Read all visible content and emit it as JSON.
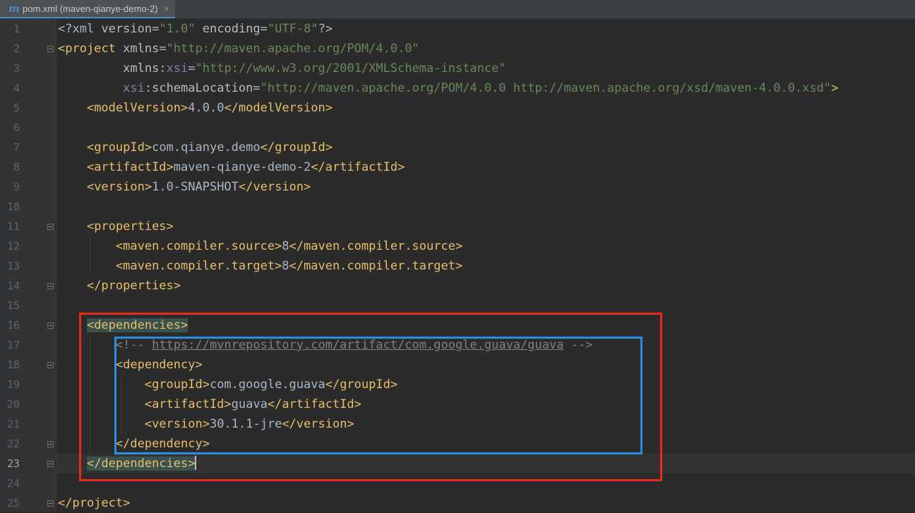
{
  "tab": {
    "icon": "maven-m-icon",
    "icon_glyph": "m",
    "title": "pom.xml (maven-qianye-demo-2)",
    "close_glyph": "×"
  },
  "current_line": 23,
  "lines": [
    {
      "n": "1",
      "tokens": [
        [
          "p",
          "<?xml "
        ],
        [
          "a",
          "version"
        ],
        [
          "p",
          "="
        ],
        [
          "v",
          "\"1.0\""
        ],
        [
          "p",
          " "
        ],
        [
          "a",
          "encoding"
        ],
        [
          "p",
          "="
        ],
        [
          "v",
          "\"UTF-8\""
        ],
        [
          "p",
          "?>"
        ]
      ]
    },
    {
      "n": "2",
      "tokens": [
        [
          "t",
          "<project "
        ],
        [
          "a",
          "xmlns"
        ],
        [
          "p",
          "="
        ],
        [
          "v",
          "\"http://maven.apache.org/POM/4.0.0\""
        ]
      ]
    },
    {
      "n": "3",
      "tokens": [
        [
          "p",
          "         "
        ],
        [
          "a",
          "xmlns"
        ],
        [
          "p",
          ":"
        ],
        [
          "n",
          "xsi"
        ],
        [
          "p",
          "="
        ],
        [
          "v",
          "\"http://www.w3.org/2001/XMLSchema-instance\""
        ]
      ]
    },
    {
      "n": "4",
      "tokens": [
        [
          "p",
          "         "
        ],
        [
          "n",
          "xsi"
        ],
        [
          "p",
          ":"
        ],
        [
          "a",
          "schemaLocation"
        ],
        [
          "p",
          "="
        ],
        [
          "v",
          "\"http://maven.apache.org/POM/4.0.0 http://maven.apache.org/xsd/maven-4.0.0.xsd\""
        ],
        [
          "t",
          ">"
        ]
      ]
    },
    {
      "n": "5",
      "tokens": [
        [
          "p",
          "    "
        ],
        [
          "t",
          "<modelVersion>"
        ],
        [
          "x",
          "4.0.0"
        ],
        [
          "t",
          "</modelVersion>"
        ]
      ]
    },
    {
      "n": "6",
      "tokens": []
    },
    {
      "n": "7",
      "tokens": [
        [
          "p",
          "    "
        ],
        [
          "t",
          "<groupId>"
        ],
        [
          "x",
          "com.qianye.demo"
        ],
        [
          "t",
          "</groupId>"
        ]
      ]
    },
    {
      "n": "8",
      "tokens": [
        [
          "p",
          "    "
        ],
        [
          "t",
          "<artifactId>"
        ],
        [
          "x",
          "maven-qianye-demo-2"
        ],
        [
          "t",
          "</artifactId>"
        ]
      ]
    },
    {
      "n": "9",
      "tokens": [
        [
          "p",
          "    "
        ],
        [
          "t",
          "<version>"
        ],
        [
          "x",
          "1.0-SNAPSHOT"
        ],
        [
          "t",
          "</version>"
        ]
      ]
    },
    {
      "n": "10",
      "tokens": []
    },
    {
      "n": "11",
      "tokens": [
        [
          "p",
          "    "
        ],
        [
          "t",
          "<properties>"
        ]
      ]
    },
    {
      "n": "12",
      "tokens": [
        [
          "p",
          "        "
        ],
        [
          "t",
          "<maven.compiler.source>"
        ],
        [
          "x",
          "8"
        ],
        [
          "t",
          "</maven.compiler.source>"
        ]
      ]
    },
    {
      "n": "13",
      "tokens": [
        [
          "p",
          "        "
        ],
        [
          "t",
          "<maven.compiler.target>"
        ],
        [
          "x",
          "8"
        ],
        [
          "t",
          "</maven.compiler.target>"
        ]
      ]
    },
    {
      "n": "14",
      "tokens": [
        [
          "p",
          "    "
        ],
        [
          "t",
          "</properties>"
        ]
      ]
    },
    {
      "n": "15",
      "tokens": []
    },
    {
      "n": "16",
      "tokens": [
        [
          "p",
          "    "
        ],
        [
          "h",
          "<dependencies>"
        ]
      ]
    },
    {
      "n": "17",
      "tokens": [
        [
          "p",
          "        "
        ],
        [
          "c",
          "<!-- "
        ],
        [
          "l",
          "https://mvnrepository.com/artifact/com.google.guava/guava"
        ],
        [
          "c",
          " -->"
        ]
      ]
    },
    {
      "n": "18",
      "tokens": [
        [
          "p",
          "        "
        ],
        [
          "t",
          "<dependency>"
        ]
      ]
    },
    {
      "n": "19",
      "tokens": [
        [
          "p",
          "            "
        ],
        [
          "t",
          "<groupId>"
        ],
        [
          "x",
          "com.google.guava"
        ],
        [
          "t",
          "</groupId>"
        ]
      ]
    },
    {
      "n": "20",
      "tokens": [
        [
          "p",
          "            "
        ],
        [
          "t",
          "<artifactId>"
        ],
        [
          "x",
          "guava"
        ],
        [
          "t",
          "</artifactId>"
        ]
      ]
    },
    {
      "n": "21",
      "tokens": [
        [
          "p",
          "            "
        ],
        [
          "t",
          "<version>"
        ],
        [
          "x",
          "30.1.1-jre"
        ],
        [
          "t",
          "</version>"
        ]
      ]
    },
    {
      "n": "22",
      "tokens": [
        [
          "p",
          "        "
        ],
        [
          "t",
          "</dependency>"
        ]
      ]
    },
    {
      "n": "23",
      "tokens": [
        [
          "p",
          "    "
        ],
        [
          "h",
          "</dependencies>"
        ],
        [
          "caret",
          ""
        ]
      ]
    },
    {
      "n": "24",
      "tokens": []
    },
    {
      "n": "25",
      "tokens": [
        [
          "t",
          "</project>"
        ]
      ]
    }
  ],
  "folds": [
    {
      "line": 2,
      "kind": "open"
    },
    {
      "line": 11,
      "kind": "open"
    },
    {
      "line": 14,
      "kind": "end"
    },
    {
      "line": 16,
      "kind": "open"
    },
    {
      "line": 18,
      "kind": "open"
    },
    {
      "line": 22,
      "kind": "end"
    },
    {
      "line": 23,
      "kind": "end"
    },
    {
      "line": 25,
      "kind": "end"
    }
  ],
  "colors": {
    "background": "#2b2b2b",
    "gutter": "#313335",
    "tag": "#e8bf6a",
    "attribute": "#bababa",
    "namespace": "#9876aa",
    "string": "#6a8759",
    "text": "#a9b7c6",
    "comment": "#808080",
    "highlight_bg": "#3b514d",
    "annotation_red": "#e8291c",
    "annotation_blue": "#2e8ee6"
  }
}
